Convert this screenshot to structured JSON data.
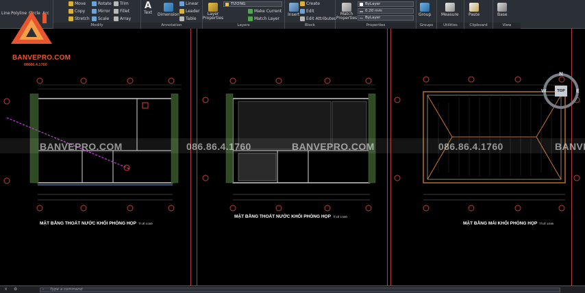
{
  "ribbon": {
    "groups": {
      "modify": {
        "title": "Modify",
        "items": [
          "Move",
          "Rotate",
          "Trim",
          "Copy",
          "Mirror",
          "Fillet",
          "Stretch",
          "Scale",
          "Array"
        ]
      },
      "draw": {
        "items": [
          "Line",
          "Polyline",
          "Circle",
          "Arc"
        ]
      },
      "annotation": {
        "title": "Annotation",
        "text_label": "Text",
        "dimension_label": "Dimension",
        "items": [
          "Linear",
          "Leader",
          "Table"
        ]
      },
      "layers": {
        "title": "Layers",
        "properties_label": "Layer Properties",
        "current_layer": "TƯỜNG",
        "make_current_label": "Make Current",
        "match_layer_label": "Match Layer"
      },
      "block": {
        "title": "Block",
        "insert_label": "Insert",
        "items": [
          "Create",
          "Edit",
          "Edit Attributes"
        ]
      },
      "properties": {
        "title": "Properties",
        "match_label": "Match Properties",
        "color_value": "ByLayer",
        "lineweight_value": "0.20 mm",
        "linetype_value": "ByLayer"
      },
      "groups": {
        "title": "Groups",
        "group_label": "Group"
      },
      "utilities": {
        "title": "Utilities",
        "measure_label": "Measure"
      },
      "clipboard": {
        "title": "Clipboard",
        "paste_label": "Paste"
      },
      "view": {
        "title": "View",
        "base_label": "Base"
      }
    }
  },
  "logo": {
    "name": "BANVEPRO.COM",
    "phone": "08686.4.1760"
  },
  "watermarks": [
    "BANVEPRO.COM",
    "086.86.4.1760",
    "BANVEPRO.COM",
    "086.86.4.1760",
    "BANVE"
  ],
  "drawings": [
    {
      "title": "MẶT BẰNG THOÁT NƯỚC KHỐI PHÒNG HỌP",
      "scale": "TỈ LỆ 1/100"
    },
    {
      "title": "MẶT BẰNG THOÁT NƯỚC KHỐI PHÒNG HỌP",
      "scale": "TỈ LỆ 1/100"
    },
    {
      "title": "MẶT BẰNG MÁI KHỐI PHÒNG HỌP",
      "scale": "TỈ LỆ 1/100"
    }
  ],
  "viewcube": {
    "north": "N",
    "west": "W",
    "east": "E",
    "face": "TOP"
  },
  "command_line": {
    "placeholder": "Type a command"
  },
  "colors": {
    "accent": "#e8552e",
    "viewport_frame": "#b93c3c",
    "wall": "#d8d8d8",
    "grid": "#c33c3c"
  }
}
